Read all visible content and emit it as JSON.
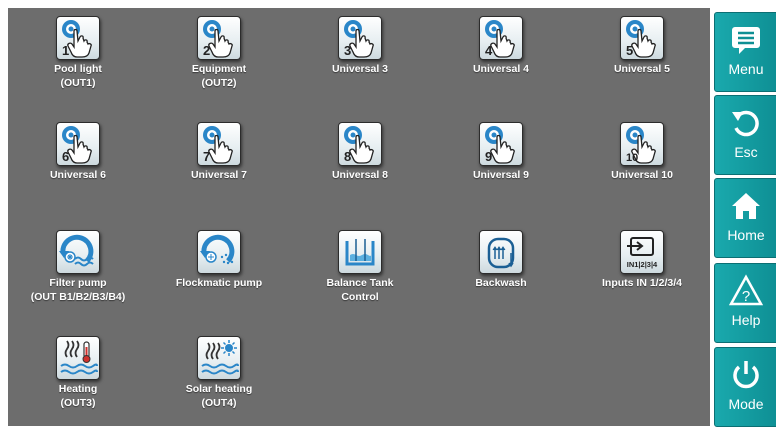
{
  "tiles": [
    {
      "id": "pool-light",
      "lines": [
        "Pool light",
        "(OUT1)"
      ],
      "icon": "hand-touch-icon",
      "badge": "1"
    },
    {
      "id": "equipment",
      "lines": [
        "Equipment",
        "(OUT2)"
      ],
      "icon": "hand-touch-icon",
      "badge": "2"
    },
    {
      "id": "universal-3",
      "lines": [
        "Universal 3",
        ""
      ],
      "icon": "hand-touch-icon",
      "badge": "3"
    },
    {
      "id": "universal-4",
      "lines": [
        "Universal 4",
        ""
      ],
      "icon": "hand-touch-icon",
      "badge": "4"
    },
    {
      "id": "universal-5",
      "lines": [
        "Universal 5",
        ""
      ],
      "icon": "hand-touch-icon",
      "badge": "5"
    },
    {
      "id": "universal-6",
      "lines": [
        "Universal 6",
        ""
      ],
      "icon": "hand-touch-icon",
      "badge": "6"
    },
    {
      "id": "universal-7",
      "lines": [
        "Universal 7",
        ""
      ],
      "icon": "hand-touch-icon",
      "badge": "7"
    },
    {
      "id": "universal-8",
      "lines": [
        "Universal 8",
        ""
      ],
      "icon": "hand-touch-icon",
      "badge": "8"
    },
    {
      "id": "universal-9",
      "lines": [
        "Universal 9",
        ""
      ],
      "icon": "hand-touch-icon",
      "badge": "9"
    },
    {
      "id": "universal-10",
      "lines": [
        "Universal 10",
        ""
      ],
      "icon": "hand-touch-icon",
      "badge": "10"
    },
    {
      "id": "filter-pump",
      "lines": [
        "Filter pump",
        "(OUT B1/B2/B3/B4)"
      ],
      "icon": "filter-pump-icon",
      "badge": ""
    },
    {
      "id": "flockmatic-pump",
      "lines": [
        "Flockmatic pump",
        ""
      ],
      "icon": "flockmatic-pump-icon",
      "badge": ""
    },
    {
      "id": "balance-tank",
      "lines": [
        "Balance Tank",
        "Control"
      ],
      "icon": "balance-tank-icon",
      "badge": ""
    },
    {
      "id": "backwash",
      "lines": [
        "Backwash",
        ""
      ],
      "icon": "backwash-icon",
      "badge": ""
    },
    {
      "id": "inputs",
      "lines": [
        "Inputs IN 1/2/3/4",
        ""
      ],
      "icon": "inputs-icon",
      "badge": "IN1|2|3|4"
    },
    {
      "id": "heating",
      "lines": [
        "Heating",
        "(OUT3)"
      ],
      "icon": "heating-icon",
      "badge": ""
    },
    {
      "id": "solar-heating",
      "lines": [
        "Solar heating",
        "(OUT4)"
      ],
      "icon": "solar-heating-icon",
      "badge": ""
    }
  ],
  "sidebar": [
    {
      "id": "menu",
      "label": "Menu",
      "icon": "menu-icon"
    },
    {
      "id": "esc",
      "label": "Esc",
      "icon": "undo-arrow-icon"
    },
    {
      "id": "home",
      "label": "Home",
      "icon": "home-icon"
    },
    {
      "id": "help",
      "label": "Help",
      "icon": "help-icon"
    },
    {
      "id": "mode",
      "label": "Mode",
      "icon": "power-icon"
    }
  ],
  "colors": {
    "background": "#6d6d6d",
    "accent": "#15a0a5",
    "icon_blue": "#2a86c8"
  }
}
